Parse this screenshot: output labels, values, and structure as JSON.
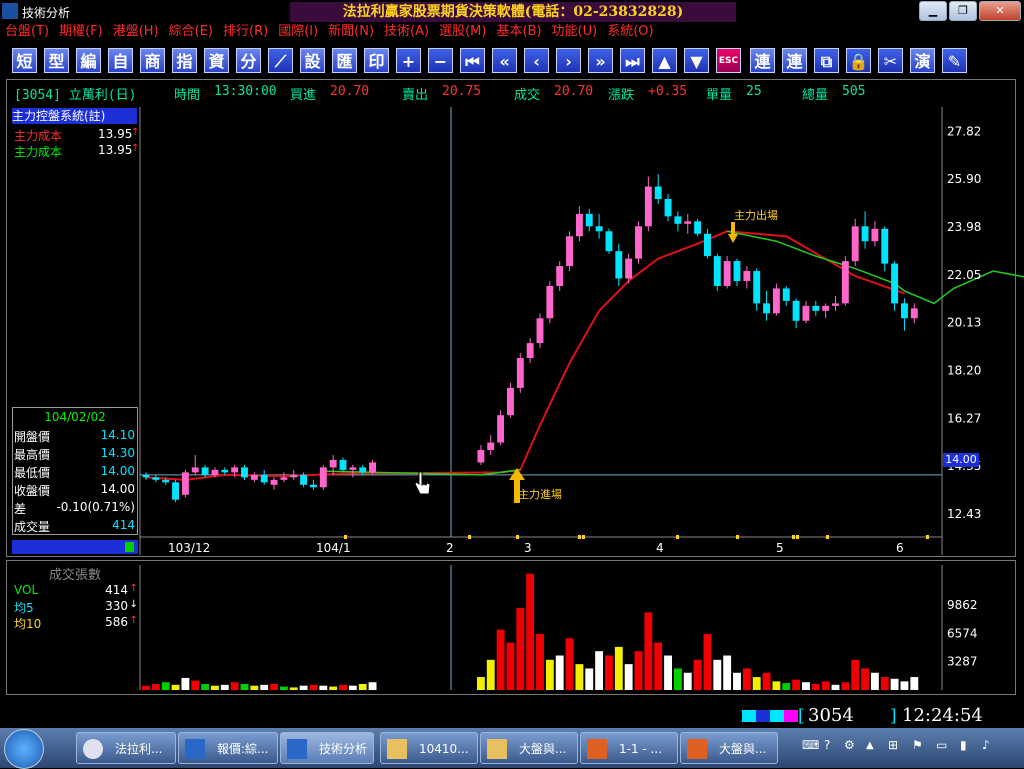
{
  "window": {
    "title": "技術分析",
    "banner": "法拉利贏家股票期貨決策軟體(電話：02-23832828)",
    "min_icon": "minimize-icon",
    "max_icon": "restore-icon",
    "close_icon": "close-icon"
  },
  "menu": [
    "台盤(T)",
    "期權(F)",
    "港盤(H)",
    "綜合(E)",
    "排行(R)",
    "國際(I)",
    "新聞(N)",
    "技術(A)",
    "選股(M)",
    "基本(B)",
    "功能(U)",
    "系統(O)"
  ],
  "toolbar": {
    "text_buttons": [
      "短",
      "型",
      "編",
      "自",
      "商",
      "指",
      "資",
      "分"
    ],
    "text_buttons2": [
      "設",
      "匯",
      "印"
    ],
    "right_buttons": [
      "連",
      "連"
    ],
    "right_buttons2": [
      "演"
    ]
  },
  "quote": {
    "symbol": "[3054] 立萬利(日)",
    "time_label": "時間",
    "time": "13:30:00",
    "bid_label": "買進",
    "bid": "20.70",
    "ask_label": "賣出",
    "ask": "20.75",
    "last_label": "成交",
    "last": "20.70",
    "chg_label": "漲跌",
    "chg": "+0.35",
    "vol_label": "單量",
    "vol": "25",
    "total_label": "總量",
    "total": "505"
  },
  "indicator": {
    "system": "主力控盤系統(註)",
    "rows": [
      {
        "label": "主力成本",
        "value": "13.95",
        "arrow": "↑",
        "color": "#ff3030"
      },
      {
        "label": "主力成本",
        "value": "13.95",
        "arrow": "↑",
        "color": "#00ee00"
      }
    ]
  },
  "ohlc": {
    "date": "104/02/02",
    "rows": [
      {
        "label": "開盤價",
        "value": "14.10",
        "color": "#00e5ff"
      },
      {
        "label": "最高價",
        "value": "14.30",
        "color": "#00e5ff"
      },
      {
        "label": "最低價",
        "value": "14.00",
        "color": "#00e5ff"
      },
      {
        "label": "收盤價",
        "value": "14.00",
        "color": "#ffffff"
      },
      {
        "label": "差",
        "value": "-0.10(0.71%)",
        "color": "#ffffff"
      },
      {
        "label": "成交量",
        "value": "414",
        "color": "#00e5ff"
      }
    ]
  },
  "annotations": {
    "entry": "主力進場",
    "exit": "主力出場"
  },
  "price_axis": {
    "ticks": [
      "27.82",
      "25.90",
      "23.98",
      "22.05",
      "20.13",
      "18.20",
      "16.27",
      "14.35",
      "12.43"
    ],
    "current": "14.00"
  },
  "date_axis": [
    "103/12",
    "104/1",
    "2",
    "3",
    "4",
    "5",
    "6"
  ],
  "volume": {
    "title": "成交張數",
    "rows": [
      {
        "label": "VOL",
        "value": "414",
        "arrow": "↑",
        "color": "#00ee00"
      },
      {
        "label": "均5",
        "value": "330",
        "arrow": "↓",
        "color": "#00e5ff"
      },
      {
        "label": "均10",
        "value": "586",
        "arrow": "↑",
        "color": "#ffd21e"
      }
    ],
    "ticks": [
      "9862",
      "6574",
      "3287"
    ]
  },
  "status": {
    "symbol": "3054",
    "clock": "12:24:54"
  },
  "taskbar": {
    "items": [
      {
        "label": "法拉利...",
        "icon": "app-f-icon"
      },
      {
        "label": "報價:綜...",
        "icon": "chart-app-icon"
      },
      {
        "label": "技術分析",
        "icon": "chart-app-icon"
      },
      {
        "label": "10410...",
        "icon": "folder-icon"
      },
      {
        "label": "大盤與...",
        "icon": "folder-icon"
      },
      {
        "label": "1-1 - ...",
        "icon": "presentation-icon"
      },
      {
        "label": "大盤與...",
        "icon": "presentation-icon"
      }
    ]
  },
  "chart_data": {
    "type": "candlestick",
    "price_ylim": [
      11.5,
      28.8
    ],
    "candles": [
      [
        14.0,
        14.1,
        13.8,
        13.9
      ],
      [
        13.9,
        14.0,
        13.7,
        13.8
      ],
      [
        13.8,
        13.9,
        13.6,
        13.7
      ],
      [
        13.7,
        13.8,
        12.9,
        13.0
      ],
      [
        13.2,
        14.2,
        13.1,
        14.1
      ],
      [
        14.1,
        14.8,
        14.0,
        14.3
      ],
      [
        14.3,
        14.4,
        13.9,
        14.0
      ],
      [
        14.0,
        14.3,
        13.9,
        14.2
      ],
      [
        14.2,
        14.3,
        14.0,
        14.1
      ],
      [
        14.1,
        14.4,
        13.9,
        14.3
      ],
      [
        14.3,
        14.4,
        13.8,
        13.9
      ],
      [
        13.8,
        14.1,
        13.7,
        14.0
      ],
      [
        14.0,
        14.2,
        13.6,
        13.7
      ],
      [
        13.6,
        13.9,
        13.4,
        13.8
      ],
      [
        13.8,
        14.1,
        13.7,
        13.9
      ],
      [
        13.9,
        14.2,
        13.8,
        14.0
      ],
      [
        14.0,
        14.1,
        13.5,
        13.6
      ],
      [
        13.6,
        13.8,
        13.4,
        13.5
      ],
      [
        13.5,
        14.4,
        13.4,
        14.3
      ],
      [
        14.3,
        14.8,
        14.0,
        14.6
      ],
      [
        14.6,
        14.7,
        14.1,
        14.2
      ],
      [
        14.2,
        14.4,
        13.9,
        14.3
      ],
      [
        14.3,
        14.4,
        14.0,
        14.1
      ],
      [
        14.1,
        14.6,
        14.0,
        14.5
      ],
      [
        14.5,
        15.2,
        14.4,
        15.0
      ],
      [
        15.0,
        15.6,
        14.8,
        15.3
      ],
      [
        15.3,
        16.6,
        15.2,
        16.4
      ],
      [
        16.4,
        17.7,
        16.3,
        17.5
      ],
      [
        17.5,
        18.9,
        17.3,
        18.7
      ],
      [
        18.7,
        19.5,
        18.5,
        19.3
      ],
      [
        19.3,
        20.5,
        19.1,
        20.3
      ],
      [
        20.3,
        21.8,
        20.1,
        21.6
      ],
      [
        21.6,
        22.6,
        21.4,
        22.4
      ],
      [
        22.4,
        23.8,
        22.2,
        23.6
      ],
      [
        23.6,
        24.8,
        23.4,
        24.5
      ],
      [
        24.5,
        24.7,
        23.8,
        24.0
      ],
      [
        24.0,
        24.5,
        23.5,
        23.8
      ],
      [
        23.8,
        23.9,
        22.9,
        23.0
      ],
      [
        23.0,
        23.3,
        21.6,
        21.9
      ],
      [
        21.9,
        22.9,
        21.7,
        22.7
      ],
      [
        22.7,
        24.2,
        22.5,
        24.0
      ],
      [
        24.0,
        26.0,
        23.8,
        25.6
      ],
      [
        25.6,
        26.1,
        24.9,
        25.1
      ],
      [
        25.1,
        25.3,
        24.2,
        24.4
      ],
      [
        24.4,
        24.6,
        23.8,
        24.1
      ],
      [
        24.1,
        24.5,
        23.7,
        24.2
      ],
      [
        24.2,
        24.3,
        23.6,
        23.7
      ],
      [
        23.7,
        23.9,
        22.7,
        22.8
      ],
      [
        22.8,
        22.9,
        21.4,
        21.6
      ],
      [
        21.6,
        22.8,
        21.5,
        22.6
      ],
      [
        22.6,
        22.7,
        21.6,
        21.8
      ],
      [
        21.8,
        22.4,
        21.5,
        22.2
      ],
      [
        22.2,
        22.3,
        20.6,
        20.9
      ],
      [
        20.9,
        21.4,
        20.2,
        20.5
      ],
      [
        20.5,
        21.7,
        20.4,
        21.5
      ],
      [
        21.5,
        21.6,
        20.8,
        21.0
      ],
      [
        21.0,
        21.1,
        19.9,
        20.2
      ],
      [
        20.2,
        21.0,
        20.1,
        20.8
      ],
      [
        20.8,
        21.0,
        20.4,
        20.6
      ],
      [
        20.6,
        20.9,
        20.3,
        20.8
      ],
      [
        20.8,
        21.2,
        20.6,
        20.9
      ],
      [
        20.9,
        22.8,
        20.8,
        22.6
      ],
      [
        22.6,
        24.3,
        22.4,
        24.0
      ],
      [
        24.0,
        24.6,
        23.1,
        23.4
      ],
      [
        23.4,
        24.2,
        23.2,
        23.9
      ],
      [
        23.9,
        24.0,
        22.2,
        22.5
      ],
      [
        22.5,
        22.6,
        20.6,
        20.9
      ],
      [
        20.9,
        21.1,
        19.8,
        20.3
      ],
      [
        20.3,
        20.9,
        20.1,
        20.7
      ]
    ],
    "red_ma": [
      [
        0,
        13.9
      ],
      [
        4,
        13.8
      ],
      [
        8,
        14.0
      ],
      [
        14,
        13.95
      ],
      [
        20,
        14.05
      ],
      [
        26,
        14.1
      ],
      [
        28,
        14.2
      ],
      [
        30,
        16.0
      ],
      [
        33,
        18.5
      ],
      [
        36,
        20.6
      ],
      [
        39,
        21.8
      ],
      [
        42,
        22.7
      ],
      [
        46,
        23.3
      ],
      [
        49,
        23.8
      ],
      [
        55,
        23.6
      ],
      [
        62,
        22.0
      ],
      [
        67,
        21.3
      ]
    ],
    "green_ma": [
      [
        18,
        14.15
      ],
      [
        24,
        14.0
      ],
      [
        28,
        14.2
      ]
    ],
    "green_ma2": [
      [
        49,
        23.8
      ],
      [
        54,
        23.4
      ],
      [
        58,
        22.8
      ],
      [
        62,
        22.3
      ],
      [
        66,
        21.7
      ],
      [
        67,
        21.4
      ],
      [
        70,
        20.9
      ],
      [
        72,
        21.5
      ],
      [
        76,
        22.2
      ],
      [
        80,
        21.9
      ]
    ],
    "volume_ylim": [
      0,
      14500
    ],
    "volume": [
      [
        500,
        "r"
      ],
      [
        700,
        "r"
      ],
      [
        900,
        "g"
      ],
      [
        600,
        "y"
      ],
      [
        1400,
        "w"
      ],
      [
        1100,
        "r"
      ],
      [
        700,
        "g"
      ],
      [
        500,
        "y"
      ],
      [
        600,
        "w"
      ],
      [
        900,
        "r"
      ],
      [
        700,
        "g"
      ],
      [
        500,
        "y"
      ],
      [
        600,
        "w"
      ],
      [
        700,
        "r"
      ],
      [
        400,
        "g"
      ],
      [
        300,
        "y"
      ],
      [
        500,
        "w"
      ],
      [
        600,
        "r"
      ],
      [
        500,
        "w"
      ],
      [
        400,
        "y"
      ],
      [
        600,
        "r"
      ],
      [
        500,
        "w"
      ],
      [
        700,
        "y"
      ],
      [
        900,
        "w"
      ],
      [
        1500,
        "y"
      ],
      [
        3500,
        "y"
      ],
      [
        7000,
        "r"
      ],
      [
        5500,
        "r"
      ],
      [
        9500,
        "r"
      ],
      [
        13500,
        "r"
      ],
      [
        6500,
        "r"
      ],
      [
        3500,
        "y"
      ],
      [
        4000,
        "w"
      ],
      [
        6000,
        "r"
      ],
      [
        3000,
        "y"
      ],
      [
        2500,
        "w"
      ],
      [
        4500,
        "w"
      ],
      [
        4000,
        "r"
      ],
      [
        5000,
        "y"
      ],
      [
        3000,
        "w"
      ],
      [
        4500,
        "r"
      ],
      [
        9000,
        "r"
      ],
      [
        5500,
        "r"
      ],
      [
        4000,
        "w"
      ],
      [
        2500,
        "g"
      ],
      [
        2000,
        "w"
      ],
      [
        3500,
        "r"
      ],
      [
        6500,
        "r"
      ],
      [
        3500,
        "w"
      ],
      [
        4000,
        "w"
      ],
      [
        2000,
        "w"
      ],
      [
        2500,
        "r"
      ],
      [
        1500,
        "y"
      ],
      [
        2000,
        "r"
      ],
      [
        1000,
        "y"
      ],
      [
        800,
        "g"
      ],
      [
        1200,
        "r"
      ],
      [
        900,
        "w"
      ],
      [
        700,
        "r"
      ],
      [
        1000,
        "r"
      ],
      [
        600,
        "w"
      ],
      [
        900,
        "r"
      ],
      [
        3500,
        "r"
      ],
      [
        2500,
        "r"
      ],
      [
        2000,
        "w"
      ],
      [
        1500,
        "r"
      ],
      [
        1300,
        "w"
      ],
      [
        1000,
        "w"
      ],
      [
        1500,
        "w"
      ]
    ]
  }
}
